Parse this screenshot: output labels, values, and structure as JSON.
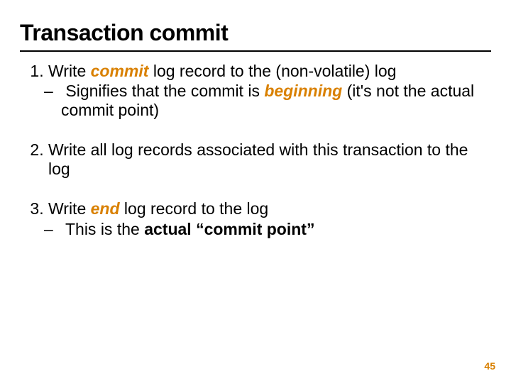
{
  "title": "Transaction commit",
  "items": {
    "i1": {
      "pre": "Write ",
      "kw": "commit",
      "post": " log record to the (non-volatile) log",
      "sub_pre": "Signifies that the commit is ",
      "sub_kw": "beginning",
      "sub_post": " (it's not the actual commit point)"
    },
    "i2": {
      "text": "Write all log records associated with this transaction to the log"
    },
    "i3": {
      "pre": "Write ",
      "kw": "end",
      "post": " log record to the log",
      "sub_pre": "This is the ",
      "sub_bold": "actual “commit point”"
    }
  },
  "page": "45"
}
